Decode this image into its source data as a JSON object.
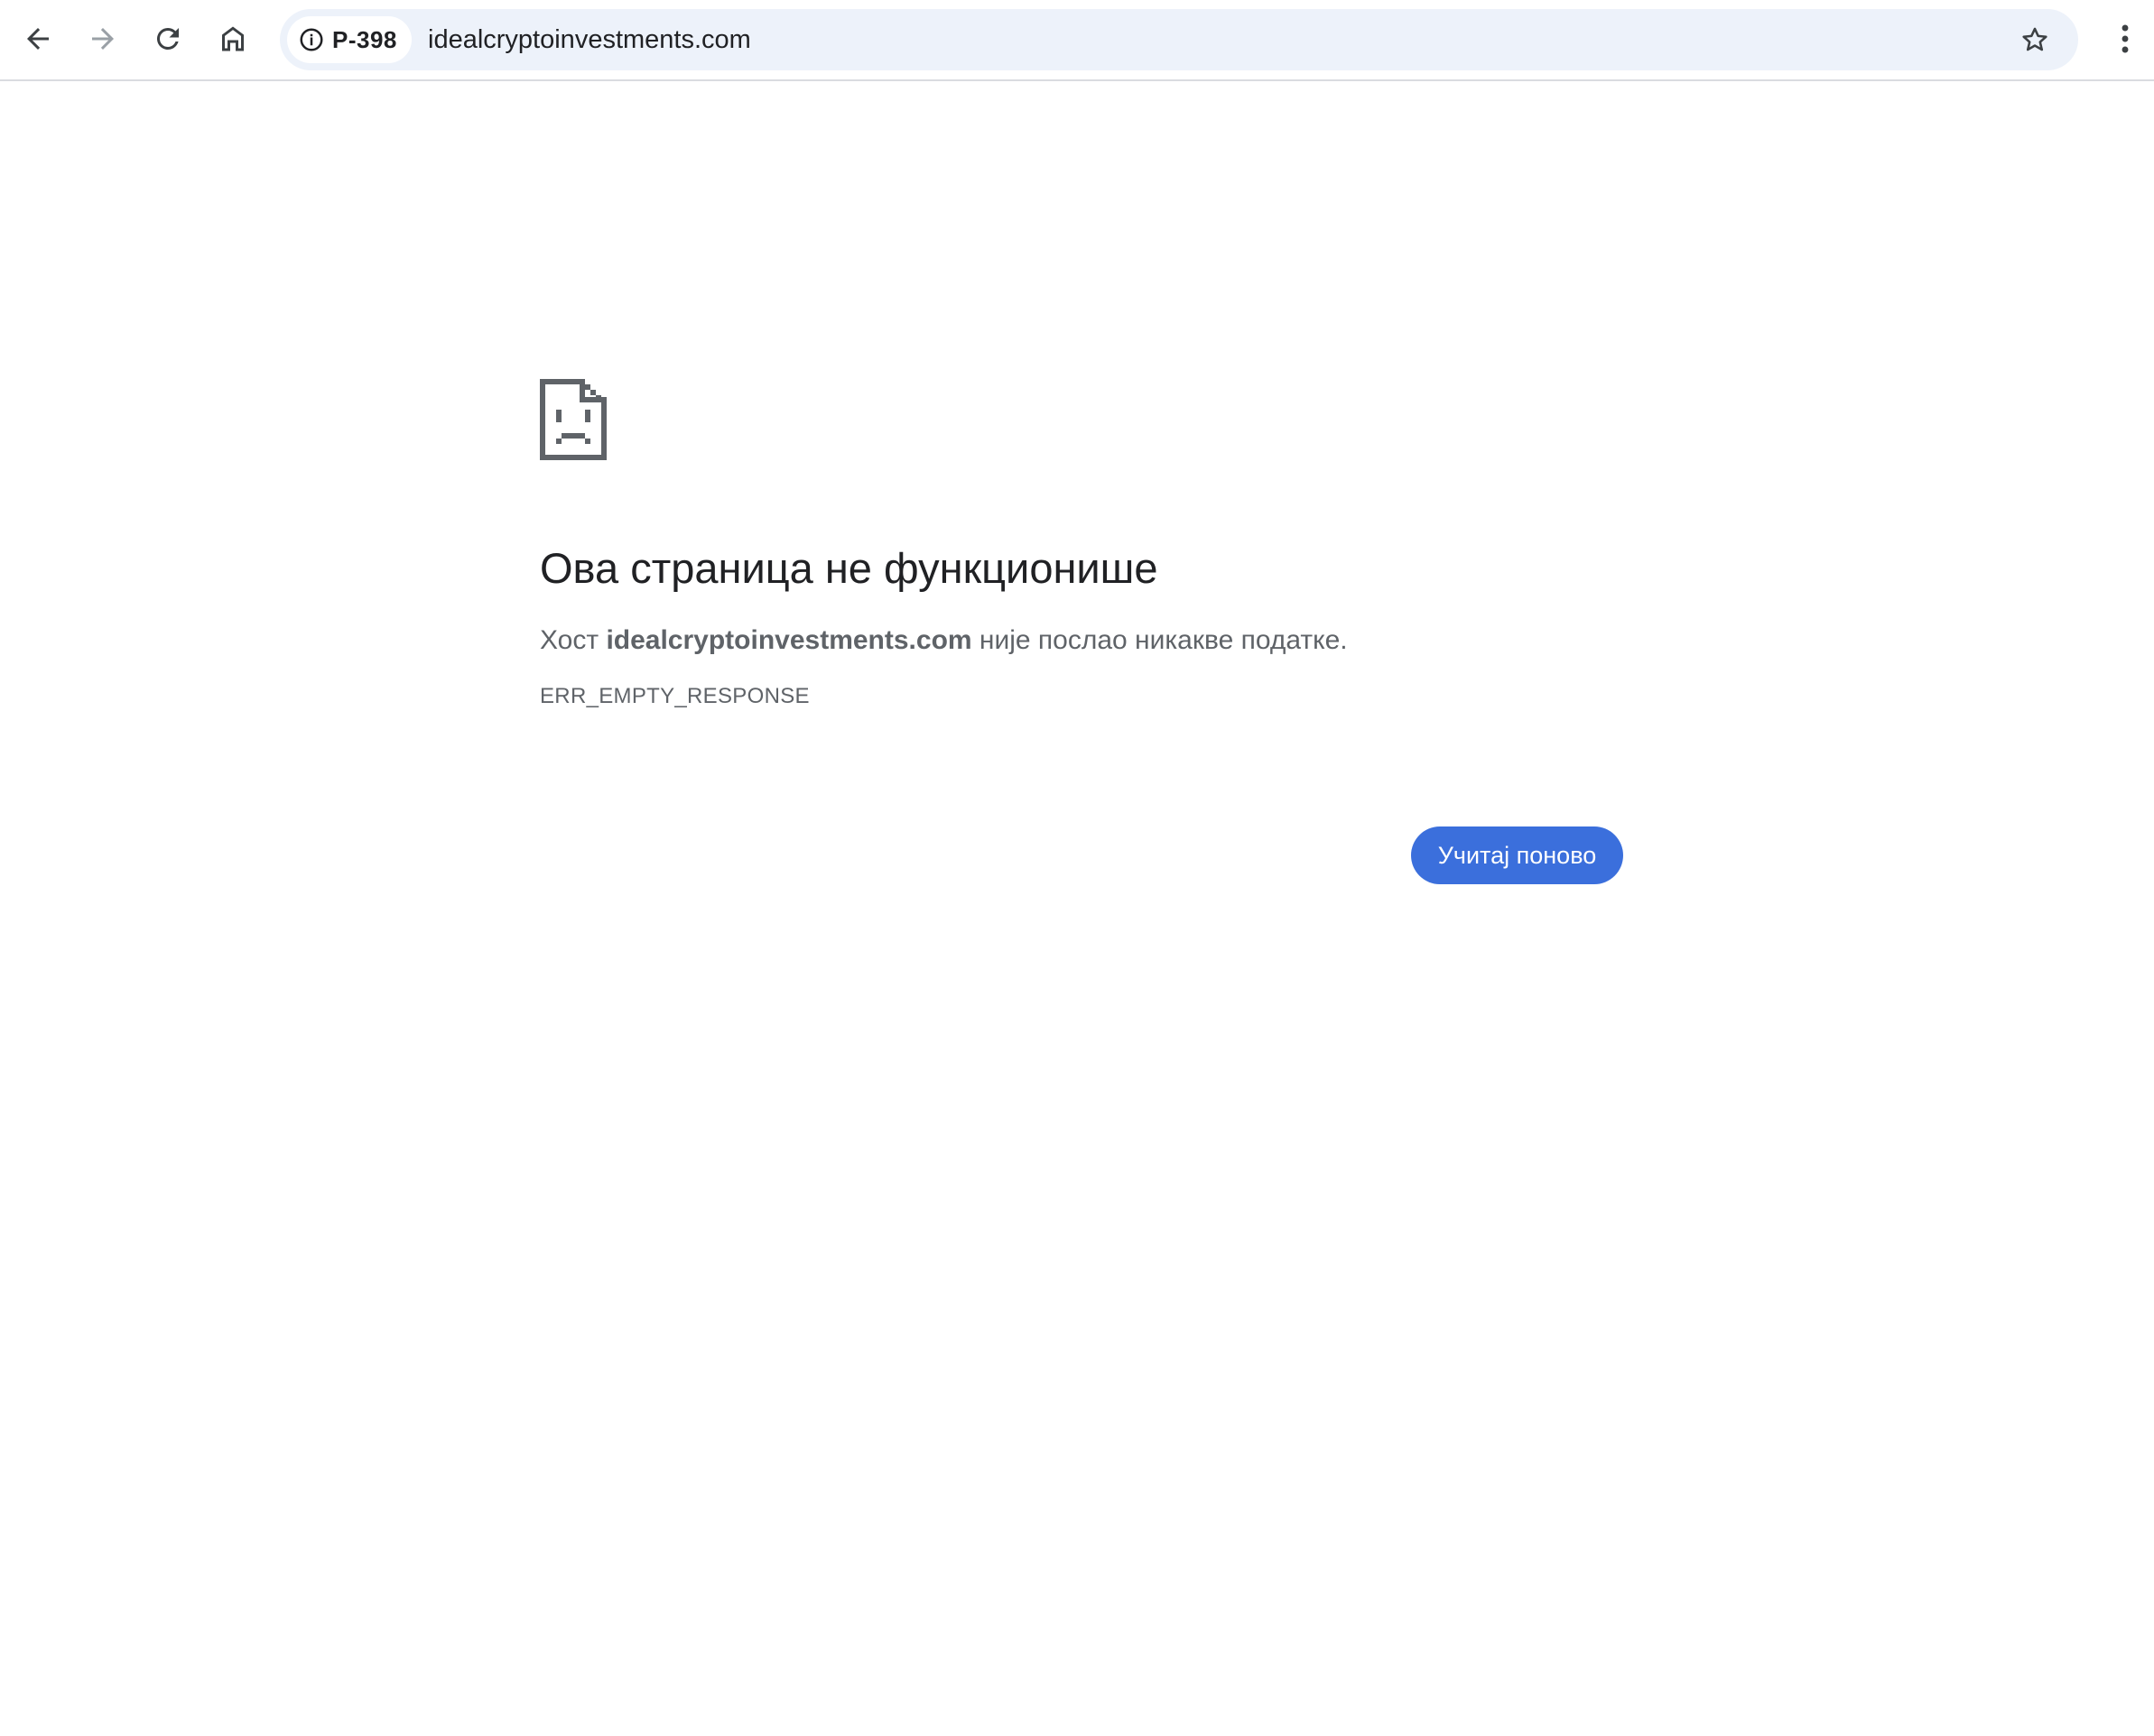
{
  "browser": {
    "site_chip_label": "P-398",
    "url": "idealcryptoinvestments.com"
  },
  "icons": {
    "back": "arrow-left-icon",
    "forward": "arrow-right-icon",
    "reload": "reload-icon",
    "home": "home-icon",
    "info": "info-icon",
    "star": "star-icon",
    "menu": "kebab-menu-icon",
    "sad_page": "sad-page-icon"
  },
  "error": {
    "title": "Ова страница не функционише",
    "desc_prefix": "Хост ",
    "host": "idealcryptoinvestments.com",
    "desc_suffix": " није послао никакве податке.",
    "code": "ERR_EMPTY_RESPONSE",
    "reload_label": "Учитај поново"
  },
  "colors": {
    "accent": "#3b6fdc",
    "omnibox_bg": "#edf2fa",
    "text_primary": "#202124",
    "text_secondary": "#5f6368"
  }
}
